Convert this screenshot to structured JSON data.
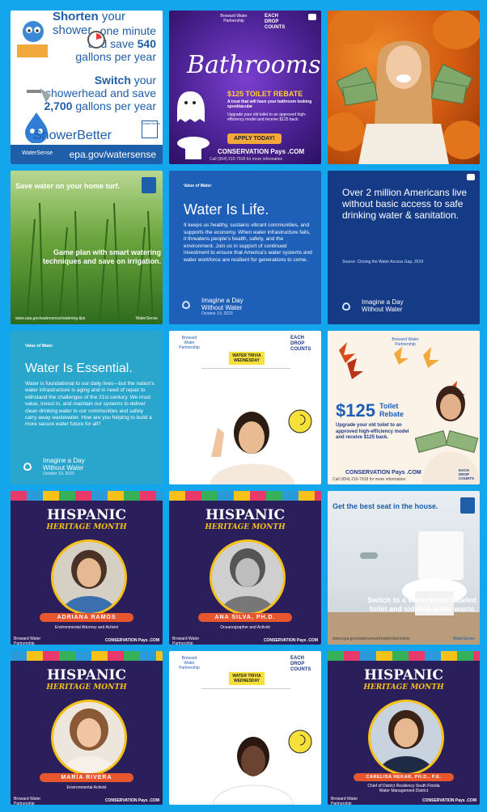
{
  "tiles": {
    "shower": {
      "line1_bold": "Shorten",
      "line1_rest": "your shower",
      "line2": "one minute",
      "line3_prefix": "and save",
      "line3_num": "540",
      "line4": "gallons per year",
      "line5_bold": "Switch",
      "line5_rest": "your",
      "line6": "showerhead and save",
      "line7_num": "2,700",
      "line7_rest": "gallons per year",
      "brand": "ShowerBetter",
      "badge": "WaterSense",
      "url": "epa.gov/watersense",
      "logo": "WaterSense"
    },
    "bathrooms": {
      "org": "Broward Water Partnership",
      "counts": "EACH DROP COUNTS",
      "title": "Bathrooms!",
      "rebate": "$125 TOILET REBATE",
      "sub": "A treat that will have your bathroom looking spooktacular",
      "desc": "Upgrade your old toilet to an approved high-efficiency model and receive $125 back.",
      "cta": "APPLY TODAY!",
      "brand": "CONSERVATION Pays .COM",
      "call": "Call (954) 210-7918 for more information"
    },
    "pumpkin": {},
    "turf": {
      "headline": "Save water on your home turf.",
      "body": "Game plan with smart watering techniques and save on irrigation.",
      "url": "www.epa.gov/watersense/watering-tips",
      "logo": "WaterSense"
    },
    "life": {
      "brand": "Value of Water",
      "title": "Water Is Life.",
      "body": "It keeps us healthy, sustains vibrant communities, and supports the economy. When water infrastructure fails, it threatens people's health, safety, and the environment. Join us in support of continued investment to ensure that America's water systems and water workforce are resilient for generations to come.",
      "footer1": "Imagine a Day",
      "footer2": "Without Water",
      "date": "October 19, 2023"
    },
    "million": {
      "headline": "Over 2 million Americans live without basic access to safe drinking water & sanitation.",
      "source": "Source: Closing the Water Access Gap, 2019",
      "footer1": "Imagine a Day",
      "footer2": "Without Water"
    },
    "essential": {
      "brand": "Value of Water",
      "title": "Water Is Essential.",
      "body": "Water is foundational to our daily lives—but the nation's water infrastructure is aging and in need of repair to withstand the challenges of the 21st century. We must value, invest in, and maintain our systems to deliver clean drinking water to our communities and safely carry away wastewater. How are you helping to build a more secure water future for all?",
      "footer1": "Imagine a Day",
      "footer2": "Without Water",
      "date": "October 19, 2023"
    },
    "trivia1": {
      "org": "Broward Water Partnership",
      "label": "WATER TRIVIA WEDNESDAY",
      "counts": "EACH DROP COUNTS"
    },
    "rebate125": {
      "org": "Broward Water Partnership",
      "amount": "$125",
      "label": "Toilet Rebate",
      "desc": "Upgrade your old toilet to an approved high-efficiency model and receive $125 back.",
      "brand": "CONSERVATION Pays .COM",
      "call": "Call (954) 210-7918 for more information.",
      "counts": "EACH DROP COUNTS"
    },
    "hispanic": [
      {
        "title": "HISPANIC",
        "sub": "HERITAGE MONTH",
        "name": "ADRIANA RAMOS",
        "role": "Environmental Attorney and Activist",
        "org": "Broward Water Partnership",
        "brand": "CONSERVATION Pays .COM"
      },
      {
        "title": "HISPANIC",
        "sub": "HERITAGE MONTH",
        "name": "ANA SILVA, PH.D.",
        "role": "Oceanographer and Activist",
        "org": "Broward Water Partnership",
        "brand": "CONSERVATION Pays .COM"
      },
      {
        "title": "HISPANIC",
        "sub": "HERITAGE MONTH",
        "name": "MARÍA RIVERA",
        "role": "Environmental Activist",
        "org": "Broward Water Partnership",
        "brand": "CONSERVATION Pays .COM"
      },
      {
        "title": "HISPANIC",
        "sub": "HERITAGE MONTH",
        "name": "CARELISA HEKAR, PH.D., P.E.",
        "role": "Chief of District Resiliency South Florida Water Management District",
        "org": "Broward Water Partnership",
        "brand": "CONSERVATION Pays .COM"
      }
    ],
    "seat": {
      "headline": "Get the best seat in the house.",
      "body": "Switch to a WaterSense labeled toilet and sideline water waste.",
      "url": "www.epa.gov/watersense/residential-toilets",
      "logo": "WaterSense"
    },
    "trivia2": {
      "org": "Broward Water Partnership",
      "label": "WATER TRIVIA WEDNESDAY",
      "counts": "EACH DROP COUNTS"
    }
  },
  "colors": {
    "frame": "#14a6ec",
    "hispanic_gold": "#f6c21a",
    "watersense_blue": "#1f5ea8"
  }
}
